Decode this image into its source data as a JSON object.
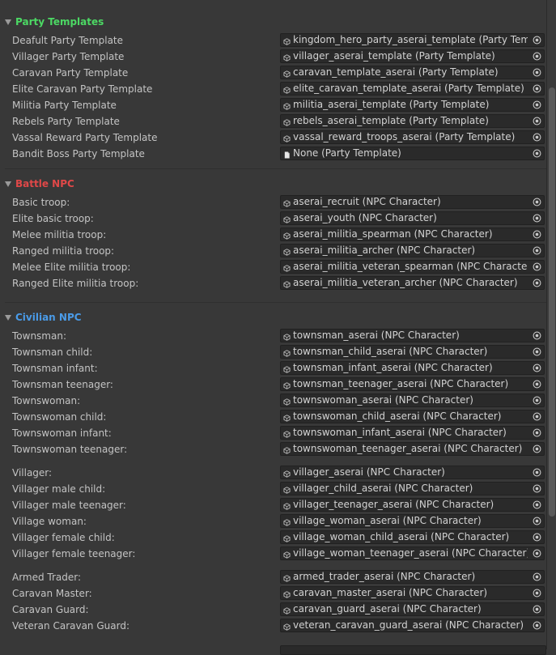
{
  "sections": [
    {
      "title": "Party Templates",
      "color": "#4cd964",
      "groups": [
        [
          {
            "label": "Deafult Party Template",
            "value": "kingdom_hero_party_aserai_template (Party Template)",
            "icon": "prefab-icon"
          },
          {
            "label": "Villager Party Template",
            "value": "villager_aserai_template (Party Template)",
            "icon": "prefab-icon"
          },
          {
            "label": "Caravan Party Template",
            "value": "caravan_template_aserai (Party Template)",
            "icon": "prefab-icon"
          },
          {
            "label": "Elite Caravan Party Template",
            "value": "elite_caravan_template_aserai (Party Template)",
            "icon": "prefab-icon"
          },
          {
            "label": "Militia Party Template",
            "value": "militia_aserai_template (Party Template)",
            "icon": "prefab-icon"
          },
          {
            "label": "Rebels Party Template",
            "value": "rebels_aserai_template (Party Template)",
            "icon": "prefab-icon"
          },
          {
            "label": "Vassal Reward Party Template",
            "value": "vassal_reward_troops_aserai (Party Template)",
            "icon": "prefab-icon"
          },
          {
            "label": "Bandit Boss Party Template",
            "value": "None (Party Template)",
            "icon": "document-icon"
          }
        ]
      ]
    },
    {
      "title": "Battle NPC",
      "color": "#e04848",
      "groups": [
        [
          {
            "label": "Basic troop:",
            "value": "aserai_recruit (NPC Character)",
            "icon": "prefab-icon"
          },
          {
            "label": "Elite basic troop:",
            "value": "aserai_youth (NPC Character)",
            "icon": "prefab-icon"
          },
          {
            "label": "Melee militia troop:",
            "value": "aserai_militia_spearman (NPC Character)",
            "icon": "prefab-icon"
          },
          {
            "label": "Ranged militia troop:",
            "value": "aserai_militia_archer (NPC Character)",
            "icon": "prefab-icon"
          },
          {
            "label": "Melee Elite militia troop:",
            "value": "aserai_militia_veteran_spearman (NPC Character)",
            "icon": "prefab-icon"
          },
          {
            "label": "Ranged Elite militia troop:",
            "value": "aserai_militia_veteran_archer (NPC Character)",
            "icon": "prefab-icon"
          }
        ]
      ]
    },
    {
      "title": "Civilian NPC",
      "color": "#4a9be8",
      "groups": [
        [
          {
            "label": "Townsman:",
            "value": "townsman_aserai (NPC Character)",
            "icon": "prefab-icon"
          },
          {
            "label": "Townsman child:",
            "value": "townsman_child_aserai (NPC Character)",
            "icon": "prefab-icon"
          },
          {
            "label": "Townsman infant:",
            "value": "townsman_infant_aserai (NPC Character)",
            "icon": "prefab-icon"
          },
          {
            "label": "Townsman teenager:",
            "value": "townsman_teenager_aserai (NPC Character)",
            "icon": "prefab-icon"
          },
          {
            "label": "Townswoman:",
            "value": "townswoman_aserai (NPC Character)",
            "icon": "prefab-icon"
          },
          {
            "label": "Townswoman child:",
            "value": "townswoman_child_aserai (NPC Character)",
            "icon": "prefab-icon"
          },
          {
            "label": "Townswoman infant:",
            "value": "townswoman_infant_aserai (NPC Character)",
            "icon": "prefab-icon"
          },
          {
            "label": "Townswoman teenager:",
            "value": "townswoman_teenager_aserai (NPC Character)",
            "icon": "prefab-icon"
          }
        ],
        [
          {
            "label": "Villager:",
            "value": "villager_aserai (NPC Character)",
            "icon": "prefab-icon"
          },
          {
            "label": "Villager male child:",
            "value": "villager_child_aserai (NPC Character)",
            "icon": "prefab-icon"
          },
          {
            "label": "Villager male teenager:",
            "value": "villager_teenager_aserai (NPC Character)",
            "icon": "prefab-icon"
          },
          {
            "label": "Village woman:",
            "value": "village_woman_aserai (NPC Character)",
            "icon": "prefab-icon"
          },
          {
            "label": "Villager female child:",
            "value": "village_woman_child_aserai (NPC Character)",
            "icon": "prefab-icon"
          },
          {
            "label": "Villager female teenager:",
            "value": "village_woman_teenager_aserai (NPC Character)",
            "icon": "prefab-icon"
          }
        ],
        [
          {
            "label": "Armed Trader:",
            "value": "armed_trader_aserai (NPC Character)",
            "icon": "prefab-icon"
          },
          {
            "label": "Caravan Master:",
            "value": "caravan_master_aserai (NPC Character)",
            "icon": "prefab-icon"
          },
          {
            "label": "Caravan Guard:",
            "value": "caravan_guard_aserai (NPC Character)",
            "icon": "prefab-icon"
          },
          {
            "label": "Veteran Caravan Guard:",
            "value": "veteran_caravan_guard_aserai (NPC Character)",
            "icon": "prefab-icon"
          }
        ]
      ]
    }
  ]
}
